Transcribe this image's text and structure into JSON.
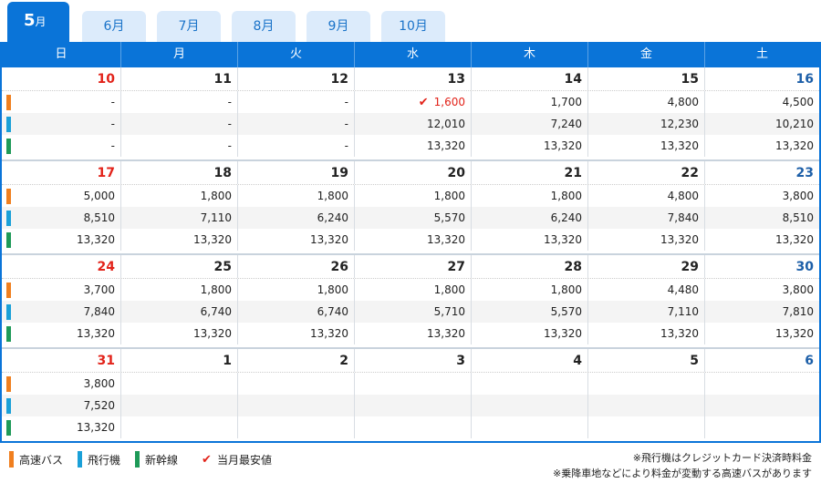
{
  "tabs": [
    {
      "label": "5月",
      "num": "5",
      "unit": "月",
      "active": true
    },
    {
      "label": "6月"
    },
    {
      "label": "7月"
    },
    {
      "label": "8月"
    },
    {
      "label": "9月"
    },
    {
      "label": "10月"
    }
  ],
  "weekdays": [
    "日",
    "月",
    "火",
    "水",
    "木",
    "金",
    "土"
  ],
  "weeks": [
    {
      "days": [
        "10",
        "11",
        "12",
        "13",
        "14",
        "15",
        "16"
      ],
      "bus": [
        "-",
        "-",
        "-",
        "1,600",
        "1,700",
        "4,800",
        "4,500"
      ],
      "air": [
        "-",
        "-",
        "-",
        "12,010",
        "7,240",
        "12,230",
        "10,210"
      ],
      "rail": [
        "-",
        "-",
        "-",
        "13,320",
        "13,320",
        "13,320",
        "13,320"
      ],
      "best_index": 3
    },
    {
      "days": [
        "17",
        "18",
        "19",
        "20",
        "21",
        "22",
        "23"
      ],
      "bus": [
        "5,000",
        "1,800",
        "1,800",
        "1,800",
        "1,800",
        "4,800",
        "3,800"
      ],
      "air": [
        "8,510",
        "7,110",
        "6,240",
        "5,570",
        "6,240",
        "7,840",
        "8,510"
      ],
      "rail": [
        "13,320",
        "13,320",
        "13,320",
        "13,320",
        "13,320",
        "13,320",
        "13,320"
      ]
    },
    {
      "days": [
        "24",
        "25",
        "26",
        "27",
        "28",
        "29",
        "30"
      ],
      "bus": [
        "3,700",
        "1,800",
        "1,800",
        "1,800",
        "1,800",
        "4,480",
        "3,800"
      ],
      "air": [
        "7,840",
        "6,740",
        "6,740",
        "5,710",
        "5,570",
        "7,110",
        "7,810"
      ],
      "rail": [
        "13,320",
        "13,320",
        "13,320",
        "13,320",
        "13,320",
        "13,320",
        "13,320"
      ]
    },
    {
      "days": [
        "31",
        "1",
        "2",
        "3",
        "4",
        "5",
        "6"
      ],
      "bus": [
        "3,800",
        "",
        "",
        "",
        "",
        "",
        ""
      ],
      "air": [
        "7,520",
        "",
        "",
        "",
        "",
        "",
        ""
      ],
      "rail": [
        "13,320",
        "",
        "",
        "",
        "",
        "",
        ""
      ]
    }
  ],
  "legend": {
    "bus": "高速バス",
    "air": "飛行機",
    "rail": "新幹線",
    "best": "当月最安値",
    "check_mark": "✔"
  },
  "notes": [
    "※飛行機はクレジットカード決済時料金",
    "※乗降車地などにより料金が変動する高速バスがあります"
  ],
  "colors": {
    "primary": "#0a74d8",
    "tab_inactive": "#dcebfb",
    "sunday": "#e2231a",
    "saturday": "#1d5fa8",
    "bus": "#f07f1f",
    "air": "#1aa0d8",
    "rail": "#1e9a58",
    "best": "#e2231a"
  }
}
